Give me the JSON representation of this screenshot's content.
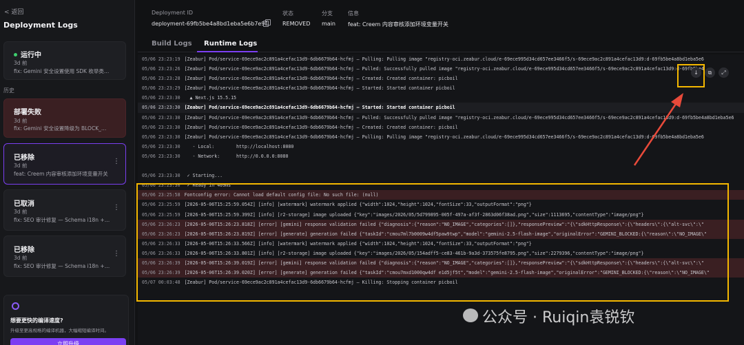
{
  "sidebar": {
    "back_label": "< 返回",
    "title": "Deployment Logs",
    "history_label": "历史",
    "current": {
      "status": "运行中",
      "date": "3d 前",
      "message": "fix: Gemini 安全设置使用 SDK 枚举类型..."
    },
    "items": [
      {
        "status": "部署失败",
        "date": "3d 前",
        "message": "fix: Gemini 安全设置降级为 BLOCK_ONLY..."
      },
      {
        "status": "已移除",
        "date": "3d 前",
        "message": "feat: Creem 内容审核添加环境变量开关"
      },
      {
        "status": "已取消",
        "date": "3d 前",
        "message": "fix: SEO 审计修复 — Schema i18n + OG 图..."
      },
      {
        "status": "已移除",
        "date": "3d 前",
        "message": "fix: SEO 审计修复 — Schema i18n + OG 图..."
      }
    ],
    "promo": {
      "title": "想要更快的编译速度?",
      "desc": "升级至更高规格的编译机器，大幅缩短编译时间。",
      "button": "立即升级"
    },
    "colors": {
      "accent": "#7b3ff2",
      "running": "#3ecf6e",
      "failed_bg": "#3a1f22"
    }
  },
  "header": {
    "labels": {
      "id": "Deployment ID",
      "status": "状态",
      "branch": "分支",
      "info": "信息"
    },
    "values": {
      "id": "deployment-69fb5be4a8bd1eba5e6b7e91",
      "status": "REMOVED",
      "branch": "main",
      "info": "feat: Creem 内容审核添加环境变量开关"
    }
  },
  "tabs": [
    {
      "label": "Build Logs",
      "active": false
    },
    {
      "label": "Runtime Logs",
      "active": true
    }
  ],
  "log_tools": [
    "download-icon",
    "copy-icon",
    "expand-icon"
  ],
  "logs": [
    {
      "ts": "05/06 23:23:19",
      "text": "[Zeabur] Pod/service-69ece9ac2c891a4cefac13d9-6db6679b64-hcfmj — Pulling: Pulling image \"registry-oci.zeabur.cloud/e-69ece995d34cd657ee3466f5/s-69ece9ac2c891a4cefac13d9:d-69fb5be4a8bd1eba5e6",
      "type": "normal"
    },
    {
      "ts": "05/06 23:23:26",
      "text": "[Zeabur] Pod/service-69ece9ac2c891a4cefac13d9-6db6679b64-hcfmj — Pulled: Successfully pulled image \"registry-oci.zeabur.cloud/e-69ece995d34cd657ee3466f5/s-69ece9ac2c891a4cefac13d9:d-69fb5be4",
      "type": "normal"
    },
    {
      "ts": "05/06 23:23:28",
      "text": "[Zeabur] Pod/service-69ece9ac2c891a4cefac13d9-6db6679b64-hcfmj — Created: Created container: picboil",
      "type": "normal"
    },
    {
      "ts": "05/06 23:23:29",
      "text": "[Zeabur] Pod/service-69ece9ac2c891a4cefac13d9-6db6679b64-hcfmj — Started: Started container picboil",
      "type": "normal"
    },
    {
      "ts": "05/06 23:23:30",
      "text": "  ▲ Next.js 15.5.15",
      "type": "normal"
    },
    {
      "ts": "05/06 23:23:30",
      "text": "[Zeabur] Pod/service-69ece9ac2c891a4cefac13d9-6db6679b64-hcfmj — Started: Started container picboil",
      "type": "bold"
    },
    {
      "ts": "05/06 23:23:30",
      "text": "[Zeabur] Pod/service-69ece9ac2c891a4cefac13d9-6db6679b64-hcfmj — Pulled: Successfully pulled image \"registry-oci.zeabur.cloud/e-69ece995d34cd657ee3466f5/s-69ece9ac2c891a4cefac13d9:d-69fb5be4a8bd1eba5e6",
      "type": "normal"
    },
    {
      "ts": "05/06 23:23:30",
      "text": "[Zeabur] Pod/service-69ece9ac2c891a4cefac13d9-6db6679b64-hcfmj — Created: Created container: picboil",
      "type": "normal"
    },
    {
      "ts": "05/06 23:23:30",
      "text": "[Zeabur] Pod/service-69ece9ac2c891a4cefac13d9-6db6679b64-hcfmj — Pulling: Pulling image \"registry-oci.zeabur.cloud/e-69ece995d34cd657ee3466f5/s-69ece9ac2c891a4cefac13d9:d-69fb5be4a8bd1eba5e6",
      "type": "normal"
    },
    {
      "ts": "05/06 23:23:30",
      "text": "   - Local:        http://localhost:8080",
      "type": "normal"
    },
    {
      "ts": "05/06 23:23:30",
      "text": "   - Network:      http://0.0.0.0:8080",
      "type": "normal"
    },
    {
      "ts": "",
      "text": "",
      "type": "normal"
    },
    {
      "ts": "05/06 23:23:30",
      "text": " ✓ Starting...",
      "type": "normal"
    },
    {
      "ts": "05/06 23:23:30",
      "text": " ✓ Ready in 409ms",
      "type": "normal"
    },
    {
      "ts": "05/06 23:25:58",
      "text": "Fontconfig error: Cannot load default config file: No such file: (null)",
      "type": "err"
    },
    {
      "ts": "05/06 23:25:59",
      "text": "[2026-05-06T15:25:59.054Z] [info] [watermark] watermark applied {\"width\":1024,\"height\":1024,\"fontSize\":33,\"outputFormat\":\"png\"}",
      "type": "normal"
    },
    {
      "ts": "05/06 23:25:59",
      "text": "[2026-05-06T15:25:59.399Z] [info] [r2-storage] image uploaded {\"key\":\"images/2026/05/5d799895-005f-497a-af3f-2863d06f38ad.png\",\"size\":1113695,\"contentType\":\"image/png\"}",
      "type": "normal"
    },
    {
      "ts": "05/06 23:26:23",
      "text": "[2026-05-06T15:26:23.818Z] [error] [gemini] response validation failed {\"diagnosis\":{\"reason\":\"NO_IMAGE\",\"categories\":[]},\"responsePreview\":\"{\\\"sdkHttpResponse\\\":{\\\"headers\\\":{\\\"alt-svc\\\":\\\"",
      "type": "err"
    },
    {
      "ts": "05/06 23:26:23",
      "text": "[2026-05-06T15:26:23.819Z] [error] [generate] generation failed {\"taskId\":\"cmou7ml7b0009w4df5paw9twp\",\"model\":\"gemini-2.5-flash-image\",\"originalError\":\"GEMINI_BLOCKED:{\\\"reason\\\":\\\"NO_IMAGE\\\"",
      "type": "err"
    },
    {
      "ts": "05/06 23:26:33",
      "text": "[2026-05-06T15:26:33.566Z] [info] [watermark] watermark applied {\"width\":1024,\"height\":1024,\"fontSize\":33,\"outputFormat\":\"png\"}",
      "type": "normal"
    },
    {
      "ts": "05/06 23:26:33",
      "text": "[2026-05-06T15:26:33.801Z] [info] [r2-storage] image uploaded {\"key\":\"images/2026/05/154adff5-ce83-461b-9a3d-373575fe8795.png\",\"size\":2279396,\"contentType\":\"image/png\"}",
      "type": "normal"
    },
    {
      "ts": "05/06 23:26:39",
      "text": "[2026-05-06T15:26:39.019Z] [error] [gemini] response validation failed {\"diagnosis\":{\"reason\":\"NO_IMAGE\",\"categories\":[]},\"responsePreview\":\"{\\\"sdkHttpResponse\\\":{\\\"headers\\\":{\\\"alt-svc\\\":\\\"",
      "type": "err"
    },
    {
      "ts": "05/06 23:26:39",
      "text": "[2026-05-06T15:26:39.020Z] [error] [generate] generation failed {\"taskId\":\"cmou7mxd1000qw4df e1d5jf5t\",\"model\":\"gemini-2.5-flash-image\",\"originalError\":\"GEMINI_BLOCKED:{\\\"reason\\\":\\\"NO_IMAGE\\\"",
      "type": "err"
    },
    {
      "ts": "05/07 00:03:48",
      "text": "[Zeabur] Pod/service-69ece9ac2c891a4cefac13d9-6db6679b64-hcfmj — Killing: Stopping container picboil",
      "type": "normal"
    }
  ],
  "watermark": "公众号 · Ruiqin袁锐钦"
}
